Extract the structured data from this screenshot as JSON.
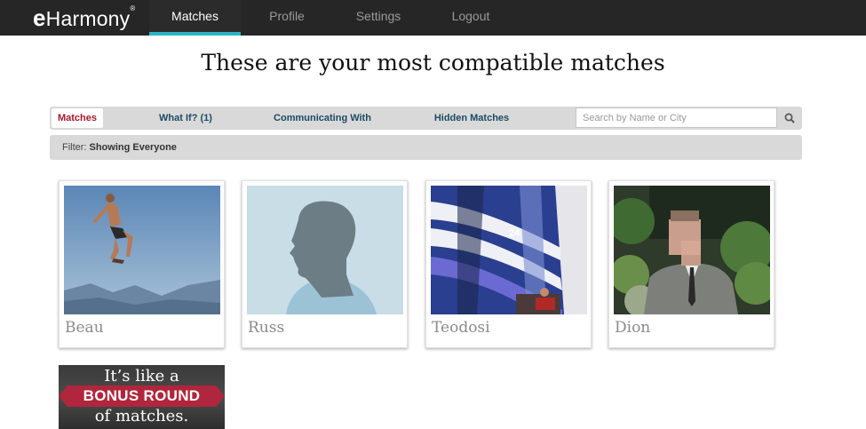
{
  "app": {
    "logo_e": "e",
    "logo_rest": "Harmony",
    "logo_mark": "®"
  },
  "nav": {
    "items": [
      {
        "label": "Matches",
        "active": true
      },
      {
        "label": "Profile",
        "active": false
      },
      {
        "label": "Settings",
        "active": false
      },
      {
        "label": "Logout",
        "active": false
      }
    ]
  },
  "headline": "These are your most compatible matches",
  "tabs": [
    {
      "label": "Matches",
      "active": true
    },
    {
      "label": "What If? (1)",
      "active": false
    },
    {
      "label": "Communicating With",
      "active": false
    },
    {
      "label": "Hidden Matches",
      "active": false
    }
  ],
  "search": {
    "placeholder": "Search by Name or City",
    "value": "",
    "icon": "search-icon"
  },
  "filter": {
    "label": "Filter:",
    "value": "Showing Everyone"
  },
  "matches": [
    {
      "name": "Beau",
      "photo": "jumping-man-photo"
    },
    {
      "name": "Russ",
      "photo": "silhouette-placeholder"
    },
    {
      "name": "Teodosi",
      "photo": "hot-air-balloon-photo"
    },
    {
      "name": "Dion",
      "photo": "man-in-garden-photo"
    }
  ],
  "promo": {
    "line1": "It’s like a",
    "line2": "BONUS ROUND",
    "line3": "of matches."
  },
  "colors": {
    "nav_bg": "#262626",
    "nav_accent": "#2bb3c6",
    "tab_active": "#a8192e",
    "tab_text": "#1b4b63",
    "promo_ribbon": "#b0263c"
  }
}
